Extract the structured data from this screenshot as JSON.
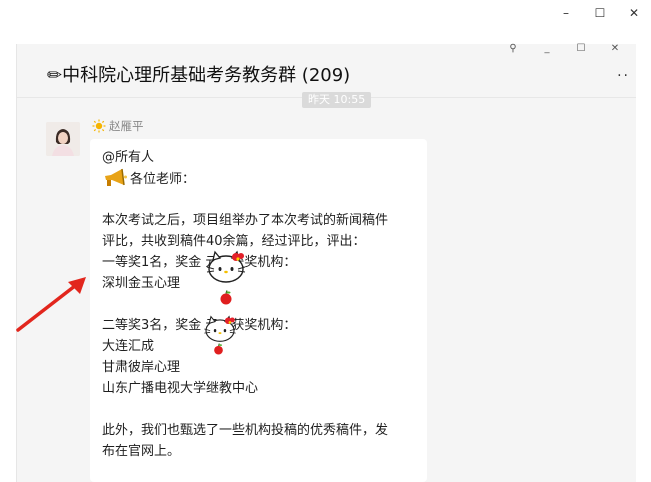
{
  "window": {
    "minimize": "–",
    "maximize": "☐",
    "close": "✕"
  },
  "chat": {
    "title": "✏中科院心理所基础考务教务群 (209)",
    "controls": {
      "pin": "⚲",
      "minimize": "_",
      "maximize": "☐",
      "close": "✕"
    },
    "more": "··",
    "timestamp": "昨天 10:55"
  },
  "message": {
    "sender": "赵雁平",
    "lines": [
      "@所有人",
      "各位老师：",
      "",
      "本次考试之后，项目组举办了本次考试的新闻稿件",
      "评比，共收到稿件40余篇，经过评比，评出：",
      "一等奖1名，奖金        元，获奖机构：",
      "深圳金玉心理",
      "",
      "二等奖3名，奖金        元，获奖机构：",
      "大连汇成",
      "甘肃彼岸心理",
      "山东广播电视大学继教中心",
      "",
      "此外，我们也甄选了一些机构投稿的优秀稿件，发",
      "布在官网上。"
    ]
  },
  "colors": {
    "arrow": "#e2261d",
    "bubble": "#ffffff",
    "chat_bg": "#f5f5f5",
    "timestamp_bg": "#dadada"
  },
  "icons": [
    "pin-icon",
    "sun-icon",
    "megaphone-icon",
    "hello-kitty-sticker",
    "apple-icon",
    "red-arrow-annotation"
  ]
}
